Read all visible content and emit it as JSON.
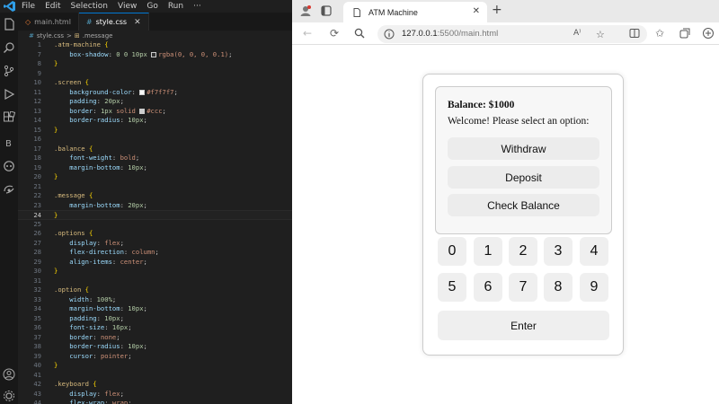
{
  "vscode": {
    "menu": [
      "File",
      "Edit",
      "Selection",
      "View",
      "Go",
      "Run",
      "···"
    ],
    "tabs": [
      {
        "label": "main.html",
        "icon": "html-file-icon"
      },
      {
        "label": "style.css",
        "icon": "css-file-icon",
        "close": "✕"
      }
    ],
    "breadcrumb": {
      "file": "style.css",
      "separator": ">",
      "symbol": ".message"
    },
    "lines": [
      {
        "n": "1",
        "parts": [
          [
            "sel",
            ".atm-machine "
          ],
          [
            "brace",
            "{"
          ]
        ]
      },
      {
        "n": "7",
        "parts": [
          [
            "prop",
            "    box-shadow"
          ],
          [
            "plain",
            ": "
          ],
          [
            "num",
            "0 0 10px "
          ],
          [
            "swatch",
            "#333333"
          ],
          [
            "val",
            "rgba(0, 0, 0, 0.1)"
          ],
          [
            "plain",
            ";"
          ]
        ]
      },
      {
        "n": "8",
        "parts": [
          [
            "brace",
            "}"
          ]
        ]
      },
      {
        "n": "9",
        "parts": []
      },
      {
        "n": "10",
        "parts": [
          [
            "sel",
            ".screen "
          ],
          [
            "brace",
            "{"
          ]
        ]
      },
      {
        "n": "11",
        "parts": [
          [
            "prop",
            "    background-color"
          ],
          [
            "plain",
            ": "
          ],
          [
            "swatch",
            "#f7f7f7"
          ],
          [
            "val",
            "#f7f7f7"
          ],
          [
            "plain",
            ";"
          ]
        ]
      },
      {
        "n": "12",
        "parts": [
          [
            "prop",
            "    padding"
          ],
          [
            "plain",
            ": "
          ],
          [
            "num",
            "20px"
          ],
          [
            "plain",
            ";"
          ]
        ]
      },
      {
        "n": "13",
        "parts": [
          [
            "prop",
            "    border"
          ],
          [
            "plain",
            ": "
          ],
          [
            "num",
            "1px "
          ],
          [
            "val",
            "solid "
          ],
          [
            "swatch",
            "#cccccc"
          ],
          [
            "val",
            "#ccc"
          ],
          [
            "plain",
            ";"
          ]
        ]
      },
      {
        "n": "14",
        "parts": [
          [
            "prop",
            "    border-radius"
          ],
          [
            "plain",
            ": "
          ],
          [
            "num",
            "10px"
          ],
          [
            "plain",
            ";"
          ]
        ]
      },
      {
        "n": "15",
        "parts": [
          [
            "brace",
            "}"
          ]
        ]
      },
      {
        "n": "16",
        "parts": []
      },
      {
        "n": "17",
        "parts": [
          [
            "sel",
            ".balance "
          ],
          [
            "brace",
            "{"
          ]
        ]
      },
      {
        "n": "18",
        "parts": [
          [
            "prop",
            "    font-weight"
          ],
          [
            "plain",
            ": "
          ],
          [
            "val",
            "bold"
          ],
          [
            "plain",
            ";"
          ]
        ]
      },
      {
        "n": "19",
        "parts": [
          [
            "prop",
            "    margin-bottom"
          ],
          [
            "plain",
            ": "
          ],
          [
            "num",
            "10px"
          ],
          [
            "plain",
            ";"
          ]
        ]
      },
      {
        "n": "20",
        "parts": [
          [
            "brace",
            "}"
          ]
        ]
      },
      {
        "n": "21",
        "parts": []
      },
      {
        "n": "22",
        "parts": [
          [
            "sel",
            ".message "
          ],
          [
            "brace",
            "{"
          ]
        ]
      },
      {
        "n": "23",
        "parts": [
          [
            "prop",
            "    margin-bottom"
          ],
          [
            "plain",
            ": "
          ],
          [
            "num",
            "20px"
          ],
          [
            "plain",
            ";"
          ]
        ]
      },
      {
        "n": "24",
        "parts": [
          [
            "brace",
            "}"
          ]
        ],
        "current": true
      },
      {
        "n": "25",
        "parts": []
      },
      {
        "n": "26",
        "parts": [
          [
            "sel",
            ".options "
          ],
          [
            "brace",
            "{"
          ]
        ]
      },
      {
        "n": "27",
        "parts": [
          [
            "prop",
            "    display"
          ],
          [
            "plain",
            ": "
          ],
          [
            "val",
            "flex"
          ],
          [
            "plain",
            ";"
          ]
        ]
      },
      {
        "n": "28",
        "parts": [
          [
            "prop",
            "    flex-direction"
          ],
          [
            "plain",
            ": "
          ],
          [
            "val",
            "column"
          ],
          [
            "plain",
            ";"
          ]
        ]
      },
      {
        "n": "29",
        "parts": [
          [
            "prop",
            "    align-items"
          ],
          [
            "plain",
            ": "
          ],
          [
            "val",
            "center"
          ],
          [
            "plain",
            ";"
          ]
        ]
      },
      {
        "n": "30",
        "parts": [
          [
            "brace",
            "}"
          ]
        ]
      },
      {
        "n": "31",
        "parts": []
      },
      {
        "n": "32",
        "parts": [
          [
            "sel",
            ".option "
          ],
          [
            "brace",
            "{"
          ]
        ]
      },
      {
        "n": "33",
        "parts": [
          [
            "prop",
            "    width"
          ],
          [
            "plain",
            ": "
          ],
          [
            "num",
            "100%"
          ],
          [
            "plain",
            ";"
          ]
        ]
      },
      {
        "n": "34",
        "parts": [
          [
            "prop",
            "    margin-bottom"
          ],
          [
            "plain",
            ": "
          ],
          [
            "num",
            "10px"
          ],
          [
            "plain",
            ";"
          ]
        ]
      },
      {
        "n": "35",
        "parts": [
          [
            "prop",
            "    padding"
          ],
          [
            "plain",
            ": "
          ],
          [
            "num",
            "10px"
          ],
          [
            "plain",
            ";"
          ]
        ]
      },
      {
        "n": "36",
        "parts": [
          [
            "prop",
            "    font-size"
          ],
          [
            "plain",
            ": "
          ],
          [
            "num",
            "16px"
          ],
          [
            "plain",
            ";"
          ]
        ]
      },
      {
        "n": "37",
        "parts": [
          [
            "prop",
            "    border"
          ],
          [
            "plain",
            ": "
          ],
          [
            "val",
            "none"
          ],
          [
            "plain",
            ";"
          ]
        ]
      },
      {
        "n": "38",
        "parts": [
          [
            "prop",
            "    border-radius"
          ],
          [
            "plain",
            ": "
          ],
          [
            "num",
            "10px"
          ],
          [
            "plain",
            ";"
          ]
        ]
      },
      {
        "n": "39",
        "parts": [
          [
            "prop",
            "    cursor"
          ],
          [
            "plain",
            ": "
          ],
          [
            "val",
            "pointer"
          ],
          [
            "plain",
            ";"
          ]
        ]
      },
      {
        "n": "40",
        "parts": [
          [
            "brace",
            "}"
          ]
        ]
      },
      {
        "n": "41",
        "parts": []
      },
      {
        "n": "42",
        "parts": [
          [
            "sel",
            ".keyboard "
          ],
          [
            "brace",
            "{"
          ]
        ]
      },
      {
        "n": "43",
        "parts": [
          [
            "prop",
            "    display"
          ],
          [
            "plain",
            ": "
          ],
          [
            "val",
            "flex"
          ],
          [
            "plain",
            ";"
          ]
        ]
      },
      {
        "n": "44",
        "parts": [
          [
            "prop",
            "    flex-wrap"
          ],
          [
            "plain",
            ": "
          ],
          [
            "val",
            "wrap"
          ],
          [
            "plain",
            ";"
          ]
        ]
      }
    ]
  },
  "browser": {
    "tab_title": "ATM Machine",
    "tab_close": "✕",
    "new_tab": "+",
    "url_host": "127.0.0.1",
    "url_path": ":5500/main.html"
  },
  "atm": {
    "balance": "Balance: $1000",
    "message": "Welcome! Please select an option:",
    "options": [
      "Withdraw",
      "Deposit",
      "Check Balance"
    ],
    "keys": [
      "0",
      "1",
      "2",
      "3",
      "4",
      "5",
      "6",
      "7",
      "8",
      "9"
    ],
    "enter": "Enter"
  },
  "colors": {
    "vscode_bg": "#1f1f1f",
    "accent": "#0078d4",
    "screen_bg": "#f7f7f7",
    "button_bg": "#efefef"
  }
}
